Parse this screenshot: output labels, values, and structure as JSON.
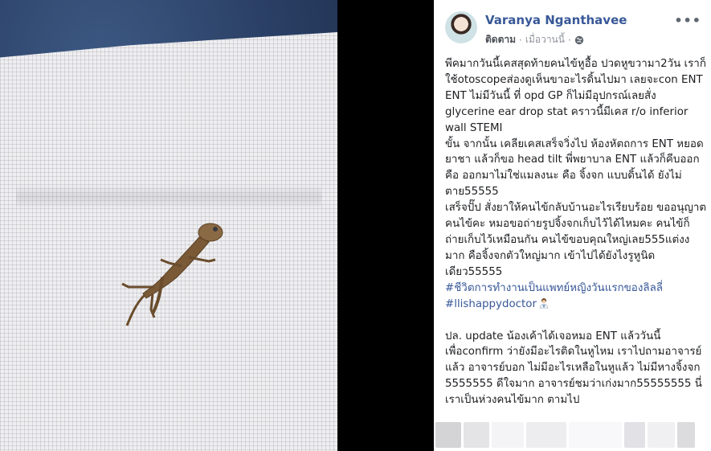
{
  "author": {
    "name": "Varanya Nganthavee",
    "follow_label": "ติดตาม",
    "separator": "·",
    "timestamp": "เมื่อวานนี้",
    "separator2": "·",
    "privacy_icon": "globe-icon"
  },
  "more_icon": "more-horizontal-icon",
  "more_label": "•••",
  "post": {
    "paragraph1": "พีคมากวันนี้เคสสุดท้ายคนไข้หูอื้อ ปวดหูขวามา2วัน เราก็ใช้otoscopeส่องดูเห็นขาอะไรดิ้นไปมา เลยจะcon ENT ENT ไม่มีวันนี้ ที่ opd GP ก็ไม่มีอุปกรณ์เลยสั่ง glycerine ear drop stat คราวนี้มีเคส r/o inferior wall STEMI",
    "paragraph2": "ขั้น จากนั้น เคลียเคสเสร็จวิ่งไป ห้องหัตถการ ENT หยอดยาชา แล้วก็ขอ head tilt พี่พยาบาล ENT แล้วก็คีบออก คือ ออกมาไม่ใช่แมลงนะ คือ จิ้งจก แบบดิ้นได้ ยังไม่ตาย55555",
    "paragraph3": "เสร็จปั๊ป สั่งยาให้คนไข้กลับบ้านอะไรเรียบร้อย ขออนุญาต คนไข้คะ หมอขอถ่ายรูปจิ้งจกเก็บไว้ได้ไหมคะ คนไข้ก็ถ่ายเก็บไว้เหมือนกัน คนไข้ขอบคุณใหญ่เลย555แต่งง มาก คือจิ้งจกตัวใหญ่มาก เข้าไปได้ยังไงรูหูนิดเดียว55555",
    "hashtag1": "#ชีวิตการทำงานเป็นแพทย์หญิงวันแรกของลิลลี่",
    "hashtag2": "#llishappydoctor",
    "emoji_icon": "female-doctor-emoji-icon",
    "paragraph4": "ปล. update น้องเค้าได้เจอหมอ ENT แล้ววันนี้ เพื่อconfirm ว่ายังมีอะไรติดในหูไหม เราไปถามอาจารย์แล้ว อาจารย์บอก ไม่มีอะไรเหลือในหูแล้ว ไม่มีหางจิ้งจก 5555555 ดีใจมาก อาจารย์ชมว่าเก่งมาก55555555 นี่เราเป็นห่วงคนไข้มาก ตามไป"
  },
  "colors": {
    "link": "#385898",
    "text": "#1c1e21",
    "meta": "#90949c"
  }
}
